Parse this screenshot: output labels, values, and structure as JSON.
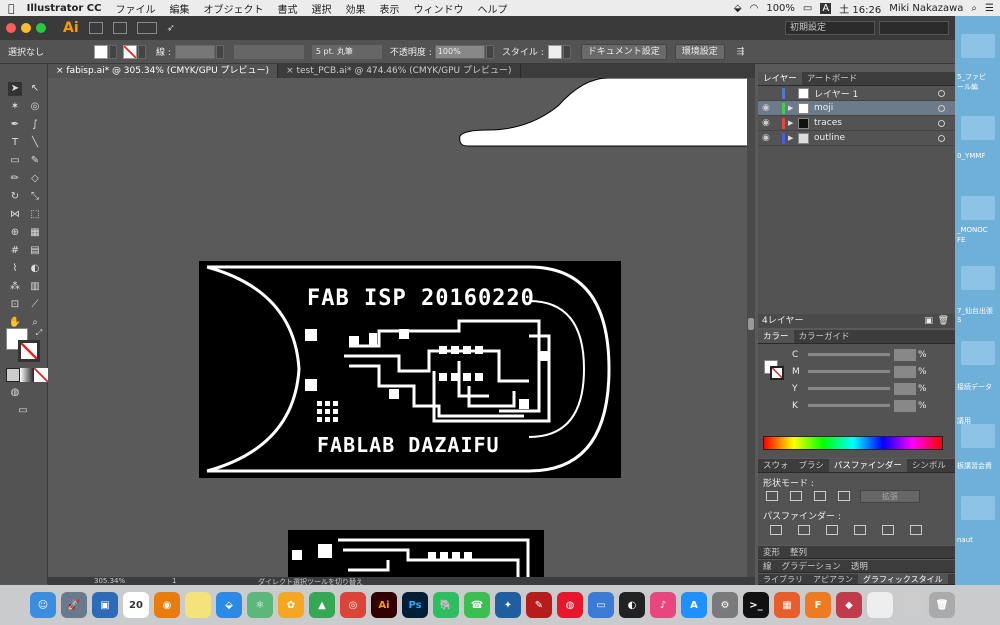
{
  "menubar": {
    "app_name": "Illustrator CC",
    "items": [
      "ファイル",
      "編集",
      "オブジェクト",
      "書式",
      "選択",
      "効果",
      "表示",
      "ウィンドウ",
      "ヘルプ"
    ],
    "battery": "100%",
    "input_mode": "A",
    "clock": "土 16:26",
    "user": "Miki Nakazawa"
  },
  "titlebar": {
    "logo": "Ai",
    "workspace": "初期設定"
  },
  "controlbar": {
    "selection": "選択なし",
    "stroke_label": "線 :",
    "brush": "5 pt. 丸筆",
    "opacity_label": "不透明度 :",
    "opacity_value": "100%",
    "style_label": "スタイル :",
    "doc_settings": "ドキュメント設定",
    "prefs": "環境設定"
  },
  "tabs": [
    {
      "label": "fabisp.ai* @ 305.34% (CMYK/GPU プレビュー)",
      "active": true
    },
    {
      "label": "test_PCB.ai* @ 474.46% (CMYK/GPU プレビュー)",
      "active": false
    }
  ],
  "artwork": {
    "top_text": "FAB ISP 20160220",
    "bottom_text": "FABLAB DAZAIFU"
  },
  "status": {
    "zoom": "305.34%",
    "page": "1",
    "tool_hint": "ダイレクト選択ツールを切り替え"
  },
  "layers_panel": {
    "tabs": [
      "レイヤー",
      "アートボード"
    ],
    "layers": [
      {
        "name": "レイヤー 1",
        "color": "#4e7ad6",
        "selected": false
      },
      {
        "name": "moji",
        "color": "#3fd04a",
        "selected": true
      },
      {
        "name": "traces",
        "color": "#e84545",
        "selected": false
      },
      {
        "name": "outline",
        "color": "#4e5ae0",
        "selected": false
      }
    ],
    "count": "4レイヤー"
  },
  "color_panel": {
    "tabs": [
      "カラー",
      "カラーガイド"
    ],
    "channels": [
      "C",
      "M",
      "Y",
      "K"
    ],
    "unit": "%"
  },
  "pathfinder_panel": {
    "tabs": [
      "スウォ",
      "ブラシ",
      "パスファインダー",
      "シンボル"
    ],
    "shape_modes": "形状モード :",
    "expand": "拡張",
    "pathfinders": "パスファインダー :"
  },
  "bottom_panels": {
    "transform_tabs": [
      "変形",
      "整列"
    ],
    "stroke_tabs": [
      "線",
      "グラデーション",
      "透明"
    ],
    "library_tabs": [
      "ライブラリ",
      "アピアラン",
      "グラフィックスタイル"
    ]
  },
  "desktop_labels": [
    "5_ファビ",
    "ール編",
    "0_YMMF",
    "_MONOC",
    "FE",
    "7_仙台出張",
    "S",
    "接続データ",
    "議用",
    "板講習会資",
    "naut"
  ],
  "dock": {
    "calendar_day": "20"
  }
}
